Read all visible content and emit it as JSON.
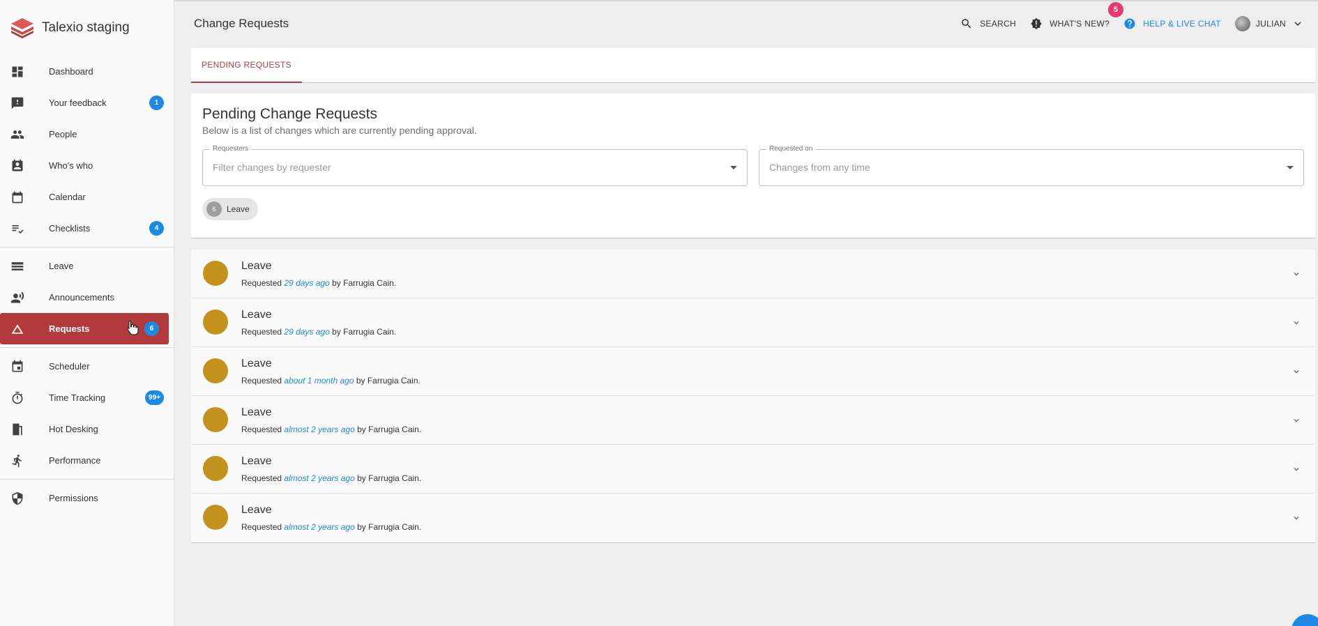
{
  "app": {
    "name": "Talexio staging"
  },
  "sidebar": {
    "items": [
      {
        "label": "Dashboard",
        "icon": "dashboard-icon",
        "badge": ""
      },
      {
        "label": "Your feedback",
        "icon": "feedback-icon",
        "badge": "1"
      },
      {
        "label": "People",
        "icon": "people-icon",
        "badge": ""
      },
      {
        "label": "Who's who",
        "icon": "contact-badge-icon",
        "badge": ""
      },
      {
        "label": "Calendar",
        "icon": "calendar-icon",
        "badge": ""
      },
      {
        "label": "Checklists",
        "icon": "checklist-icon",
        "badge": "4"
      },
      {
        "label": "Leave",
        "icon": "leave-icon",
        "badge": ""
      },
      {
        "label": "Announcements",
        "icon": "announcements-icon",
        "badge": ""
      },
      {
        "label": "Requests",
        "icon": "triangle-icon",
        "badge": "6"
      },
      {
        "label": "Scheduler",
        "icon": "scheduler-icon",
        "badge": ""
      },
      {
        "label": "Time Tracking",
        "icon": "timer-icon",
        "badge": "99+"
      },
      {
        "label": "Hot Desking",
        "icon": "door-icon",
        "badge": ""
      },
      {
        "label": "Performance",
        "icon": "running-icon",
        "badge": ""
      },
      {
        "label": "Permissions",
        "icon": "shield-icon",
        "badge": ""
      }
    ]
  },
  "header": {
    "title": "Change Requests",
    "search_label": "SEARCH",
    "whats_new_label": "WHAT'S NEW?",
    "whats_new_count": "5",
    "help_label": "HELP & LIVE CHAT",
    "user_label": "JULIAN"
  },
  "tabs": [
    {
      "label": "PENDING REQUESTS"
    }
  ],
  "filters": {
    "heading": "Pending Change Requests",
    "subheading": "Below is a list of changes which are currently pending approval.",
    "requesters_label": "Requesters",
    "requesters_placeholder": "Filter changes by requester",
    "requested_on_label": "Requested on",
    "requested_on_placeholder": "Changes from any time",
    "chip": {
      "count": "6",
      "label": "Leave"
    }
  },
  "requests": [
    {
      "title": "Leave",
      "prefix": "Requested",
      "ago": "29 days ago",
      "by": "by Farrugia Cain."
    },
    {
      "title": "Leave",
      "prefix": "Requested",
      "ago": "29 days ago",
      "by": "by Farrugia Cain."
    },
    {
      "title": "Leave",
      "prefix": "Requested",
      "ago": "about 1 month ago",
      "by": "by Farrugia Cain."
    },
    {
      "title": "Leave",
      "prefix": "Requested",
      "ago": "almost 2 years ago",
      "by": "by Farrugia Cain."
    },
    {
      "title": "Leave",
      "prefix": "Requested",
      "ago": "almost 2 years ago",
      "by": "by Farrugia Cain."
    },
    {
      "title": "Leave",
      "prefix": "Requested",
      "ago": "almost 2 years ago",
      "by": "by Farrugia Cain."
    }
  ],
  "colors": {
    "accent": "#b23a3a",
    "link": "#1e88e5",
    "badge": "#1e88e5",
    "notification": "#e53970",
    "avatar_dot": "#c2921c"
  }
}
